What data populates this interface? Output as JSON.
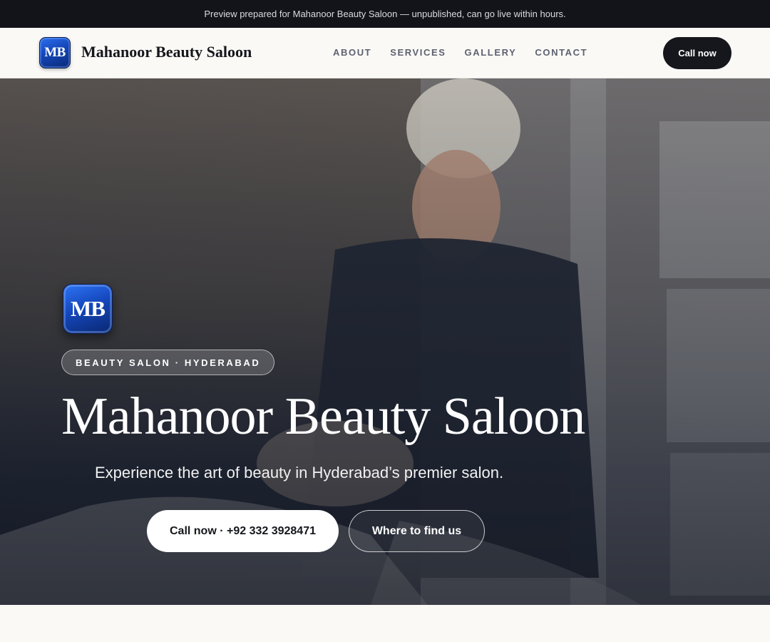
{
  "preview_bar": {
    "text": "Preview prepared for Mahanoor Beauty Saloon — unpublished, can go live within hours."
  },
  "header": {
    "logo_text": "MB",
    "brand_name": "Mahanoor Beauty Saloon",
    "nav": [
      {
        "label": "ABOUT"
      },
      {
        "label": "SERVICES"
      },
      {
        "label": "GALLERY"
      },
      {
        "label": "CONTACT"
      }
    ],
    "cta_label": "Call now"
  },
  "hero": {
    "logo_text": "MB",
    "badge": "BEAUTY SALON · HYDERABAD",
    "title": "Mahanoor Beauty Saloon",
    "subtitle": "Experience the art of beauty in Hyderabad’s premier salon.",
    "primary_button": "Call now · +92 332 3928471",
    "secondary_button": "Where to find us"
  },
  "colors": {
    "dark": "#15171c",
    "brand_blue": "#1548bd",
    "page_bg": "#faf9f6"
  }
}
